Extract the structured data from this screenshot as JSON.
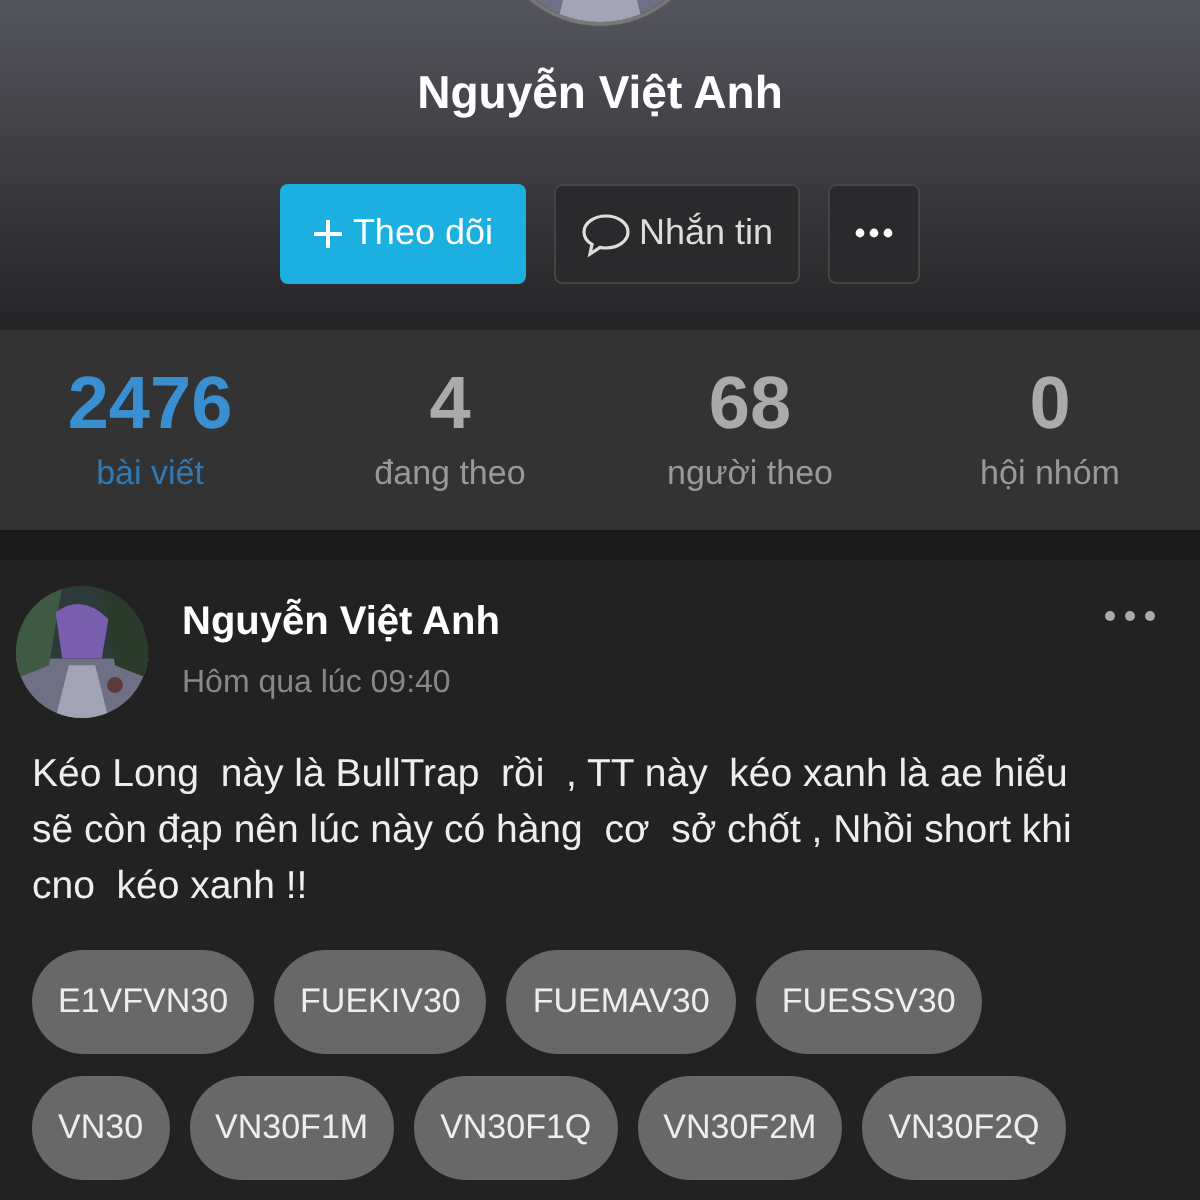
{
  "profile": {
    "avatar": {
      "kind": "picture"
    },
    "name": "Nguyễn Việt Anh",
    "actions": [
      {
        "kind": "follow",
        "label": "Theo dõi"
      },
      {
        "kind": "message",
        "label": "Nhắn tin"
      },
      {
        "kind": "more"
      }
    ]
  },
  "stats": [
    {
      "value": "2476",
      "label": "bài viết",
      "selected": true
    },
    {
      "value": "4",
      "label": "đang theo",
      "selected": false
    },
    {
      "value": "68",
      "label": "người theo",
      "selected": false
    },
    {
      "value": "0",
      "label": "hội nhóm",
      "selected": false
    }
  ],
  "post": {
    "avatar": {
      "kind": "picture"
    },
    "author": "Nguyễn Việt Anh",
    "time": "Hôm qua lúc 09:40",
    "text": "Kéo Long  này là BullTrap  rồi  , TT này  kéo xanh là ae hiểu sẽ còn đạp nên lúc này có hàng  cơ  sở chốt , Nhồi short khi cno  kéo xanh !!",
    "tags": [
      [
        "E1VFVN30",
        "FUEKIV30",
        "FUEMAV30",
        "FUESSV30"
      ],
      [
        "VN30",
        "VN30F1M",
        "VN30F1Q",
        "VN30F2M",
        "VN30F2Q"
      ]
    ]
  }
}
